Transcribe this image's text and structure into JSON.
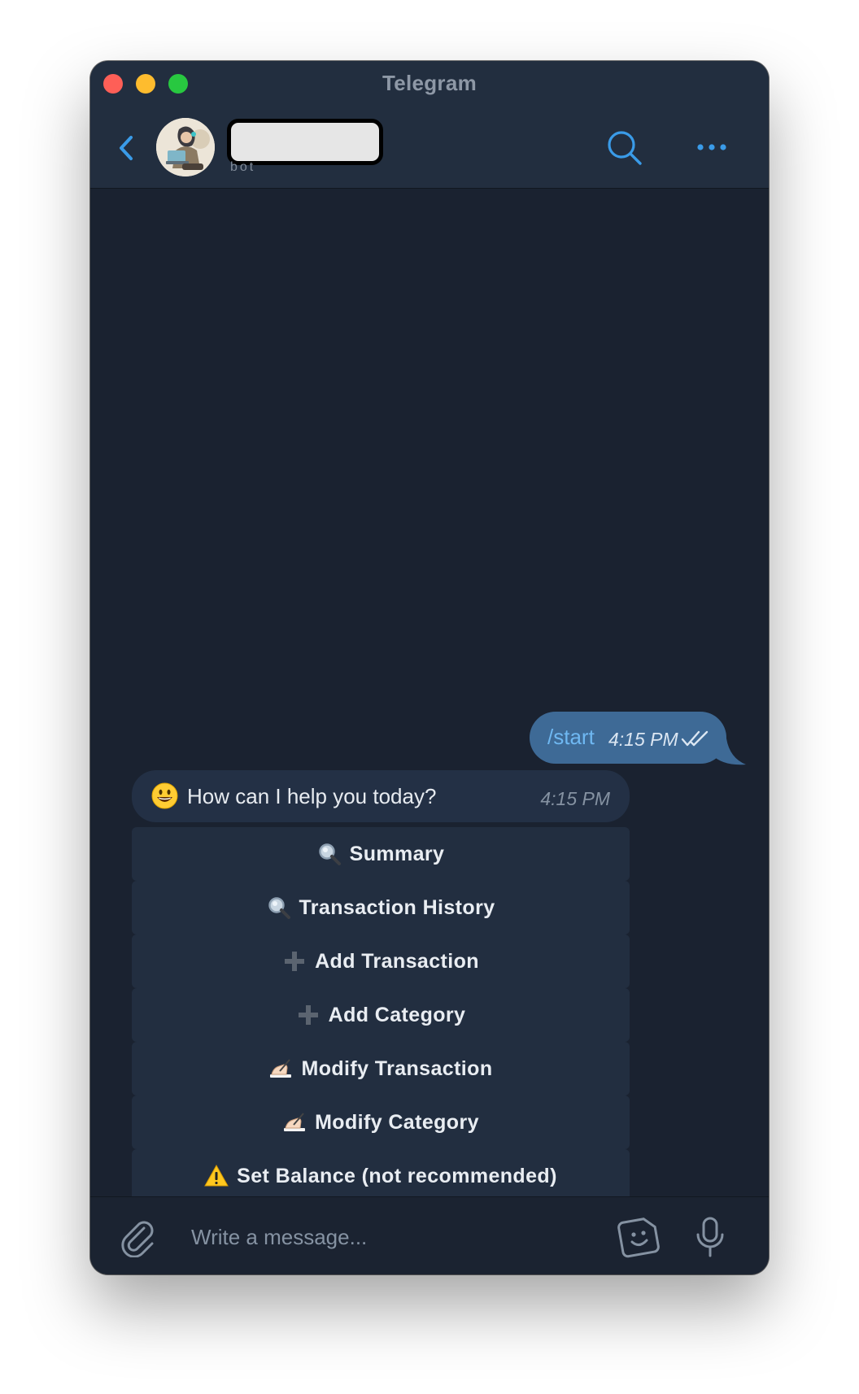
{
  "window": {
    "title": "Telegram"
  },
  "header": {
    "chat_subtitle": "bot",
    "icons": {
      "back": "chevron-left-icon",
      "search": "search-icon",
      "more": "more-dots-icon"
    },
    "accent_color": "#3a9be8"
  },
  "messages": [
    {
      "direction": "outgoing",
      "text": "/start",
      "time": "4:15 PM",
      "status": "read"
    },
    {
      "direction": "incoming",
      "emoji": "smiley-face-icon",
      "text": "How can I help you today?",
      "time": "4:15 PM"
    }
  ],
  "inline_keyboard": [
    {
      "icon": "magnifier-icon",
      "label": "Summary"
    },
    {
      "icon": "magnifier-icon",
      "label": "Transaction History"
    },
    {
      "icon": "plus-icon",
      "label": "Add Transaction"
    },
    {
      "icon": "plus-icon",
      "label": "Add Category"
    },
    {
      "icon": "writing-hand-icon",
      "label": "Modify Transaction"
    },
    {
      "icon": "writing-hand-icon",
      "label": "Modify Category"
    },
    {
      "icon": "warning-icon",
      "label": "Set Balance (not recommended)"
    }
  ],
  "composer": {
    "placeholder": "Write a message...",
    "icons": {
      "attach": "paperclip-icon",
      "sticker": "sticker-icon",
      "mic": "microphone-icon"
    }
  },
  "colors": {
    "window_bg": "#1a2230",
    "header_bg": "#222e3f",
    "outgoing_bubble": "#3e6a96",
    "incoming_bubble": "#233045",
    "keyboard_button": "#222e40"
  }
}
